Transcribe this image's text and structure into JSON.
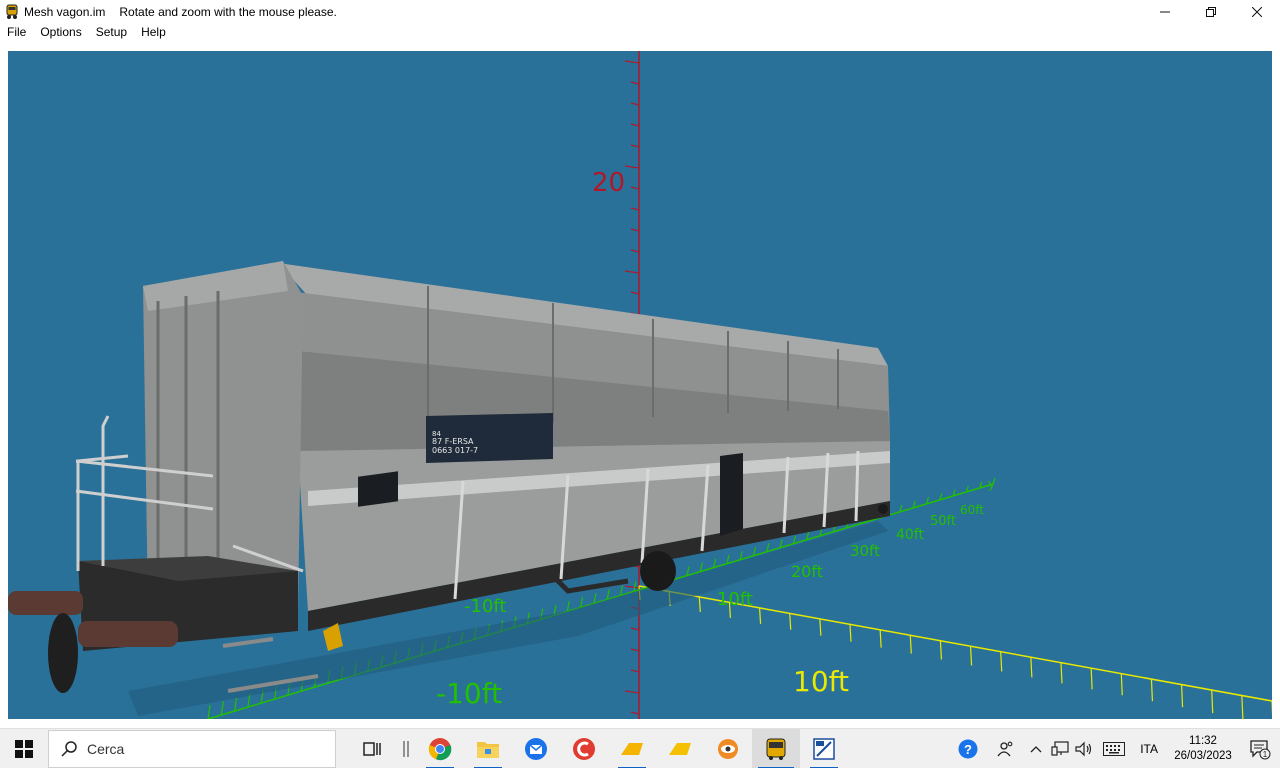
{
  "window": {
    "app_name": "Mesh vagon.im",
    "message": "Rotate and zoom with the mouse please.",
    "minimize_icon": "minimize-icon",
    "maximize_icon": "restore-icon",
    "close_icon": "close-icon"
  },
  "menu": {
    "items": [
      "File",
      "Options",
      "Setup",
      "Help"
    ]
  },
  "viewport": {
    "background": "#2a7199",
    "vertical_axis_label": "20",
    "x_axis_labels": [
      "-10ft",
      "10ft"
    ],
    "y_axis_labels": [
      "-10ft",
      "10ft",
      "20ft",
      "30ft",
      "40ft",
      "50ft",
      "60ft"
    ],
    "y_axis_end": "y",
    "wagon_plate": {
      "line1": "84",
      "line2": "87 F-ERSA",
      "line3": "0663 017-7"
    }
  },
  "taskbar": {
    "search_placeholder": "Cerca",
    "apps": [
      "task-view",
      "separator",
      "chrome",
      "file-explorer",
      "thunderbird",
      "ccleaner",
      "app-yellow-1",
      "app-yellow-2",
      "eye-app",
      "bus-app",
      "mesh-app"
    ],
    "language": "ITA",
    "time": "11:32",
    "date": "26/03/2023",
    "notification_count": "1"
  },
  "colors": {
    "accent": "#0a64c8",
    "axis_green": "#22c000",
    "axis_yellow": "#e8e800",
    "axis_red": "#b0182a"
  }
}
